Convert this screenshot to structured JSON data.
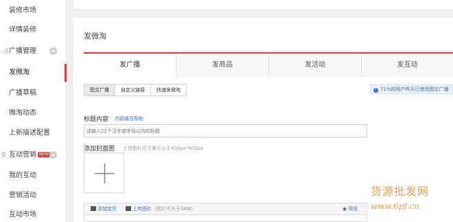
{
  "sidebar": {
    "items": [
      {
        "label": "装修市场"
      },
      {
        "label": "详情装修"
      },
      {
        "label": "广播管理"
      },
      {
        "label": "发微淘"
      },
      {
        "label": "广播草稿"
      },
      {
        "label": "微淘动态"
      },
      {
        "label": "上新描述配置"
      },
      {
        "label": "互动营销"
      },
      {
        "label": "我的互动"
      },
      {
        "label": "营销活动"
      },
      {
        "label": "互动市场"
      }
    ],
    "new_badge": "NEW"
  },
  "panel": {
    "title": "发微淘",
    "tabs": [
      {
        "label": "发广播"
      },
      {
        "label": "发商品"
      },
      {
        "label": "发活动"
      },
      {
        "label": "发互动"
      }
    ],
    "modes": [
      {
        "label": "图文广播"
      },
      {
        "label": "自定义链接"
      },
      {
        "label": "快速发微淘"
      }
    ],
    "info_text": "71%的用户昨天已使用图文广播",
    "title_label": "标题内容",
    "title_help": "内容填写帮助",
    "title_placeholder": "请输入22个汉字或字母以内的标题",
    "cover_label": "添加封面图",
    "cover_hint": "上传图片尺寸需不小于800px*800px",
    "editor": {
      "add_item": "添加宝贝",
      "upload_image": "上传图片",
      "upload_hint": "（图片不大于3MB）",
      "preview": "预览"
    }
  },
  "watermark": {
    "line1": "货源批发网",
    "line2": "www.6pf.cn"
  }
}
